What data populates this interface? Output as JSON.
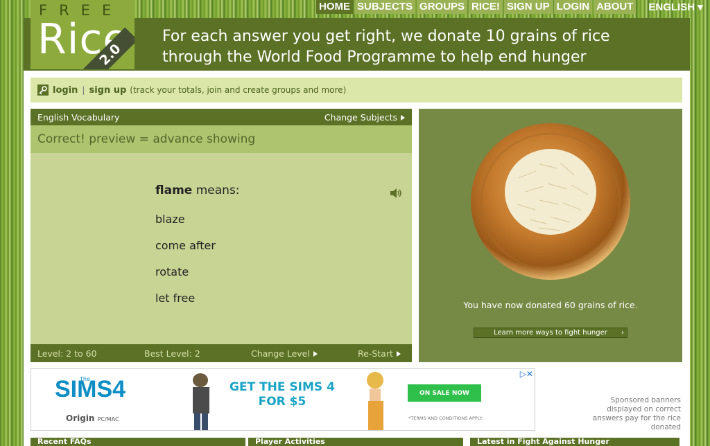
{
  "nav": {
    "items": [
      {
        "label": "HOME",
        "active": true
      },
      {
        "label": "SUBJECTS"
      },
      {
        "label": "GROUPS"
      },
      {
        "label": "RICE!"
      },
      {
        "label": "SIGN UP"
      },
      {
        "label": "LOGIN"
      },
      {
        "label": "ABOUT"
      }
    ],
    "language": "ENGLISH ▾"
  },
  "logo": {
    "free": "FREE",
    "rice": "Rice",
    "version": "2.0"
  },
  "tagline": {
    "line1": "For each answer you get right, we donate 10 grains of rice",
    "line2": "through the World Food Programme to help end hunger"
  },
  "loginbar": {
    "login": "login",
    "sep": "|",
    "signup": "sign up",
    "note": "(track your totals, join and create groups and more)"
  },
  "game": {
    "subject": "English Vocabulary",
    "change_subjects": "Change Subjects",
    "feedback": "Correct! preview = advance showing",
    "question_word": "flame",
    "question_suffix": " means:",
    "answers": [
      "blaze",
      "come after",
      "rotate",
      "let free"
    ],
    "level": "Level: 2 to 60",
    "best_level": "Best Level: 2",
    "change_level": "Change Level",
    "restart": "Re-Start"
  },
  "donation": {
    "text": "You have now donated 60 grains of rice.",
    "learn_more": "Learn more ways to fight hunger"
  },
  "ad": {
    "the": "The",
    "sims": "SIMS4",
    "origin": "Origin",
    "platform": "PC/MAC",
    "headline1": "GET THE SIMS 4",
    "headline2": "FOR $5",
    "on_sale": "ON SALE NOW",
    "terms": "*TERMS AND CONDITIONS APPLY."
  },
  "sponsor_text": "Sponsored banners displayed on correct answers pay for the rice donated",
  "footer": {
    "col1": "Recent FAQs",
    "col2": "Player Activities",
    "col3": "Latest in Fight Against Hunger"
  }
}
